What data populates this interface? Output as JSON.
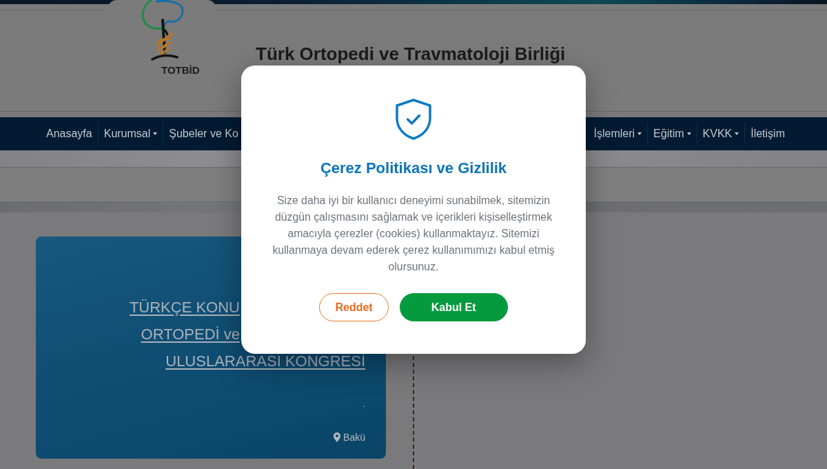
{
  "header": {
    "logo_text": "TOTBİD",
    "title": "Türk Ortopedi ve Travmatoloji Birliği"
  },
  "nav": {
    "left_items": [
      {
        "label": "Anasayfa",
        "dropdown": false
      },
      {
        "label": "Kurumsal",
        "dropdown": true
      },
      {
        "label": "Şubeler ve Ko",
        "dropdown": false
      }
    ],
    "right_items": [
      {
        "label": "İşlemleri",
        "dropdown": true
      },
      {
        "label": "Eğitim",
        "dropdown": true
      },
      {
        "label": "KVKK",
        "dropdown": true
      },
      {
        "label": "İletişim",
        "dropdown": false
      }
    ]
  },
  "event_card": {
    "title_lines": [
      "TÜRKÇE KONU",
      "ORTOPEDİ ve",
      "ULUSLARARASI KONGRESİ"
    ],
    "note": ".",
    "location": "Bakü"
  },
  "cookie_dialog": {
    "title": "Çerez Politikası ve Gizlilik",
    "message": "Size daha iyi bir kullanıcı deneyimi sunabilmek, sitemizin düzgün çalışmasını sağlamak ve içerikleri kişiselleştirmek amacıyla çerezler (cookies) kullanmaktayız. Sitemizi kullanmaya devam ederek çerez kullanımımızı kabul etmiş olursunuz.",
    "buttons": [
      {
        "label": "Reddet",
        "kind": "outline"
      },
      {
        "label": "Kabul Et",
        "kind": "primary"
      }
    ]
  }
}
